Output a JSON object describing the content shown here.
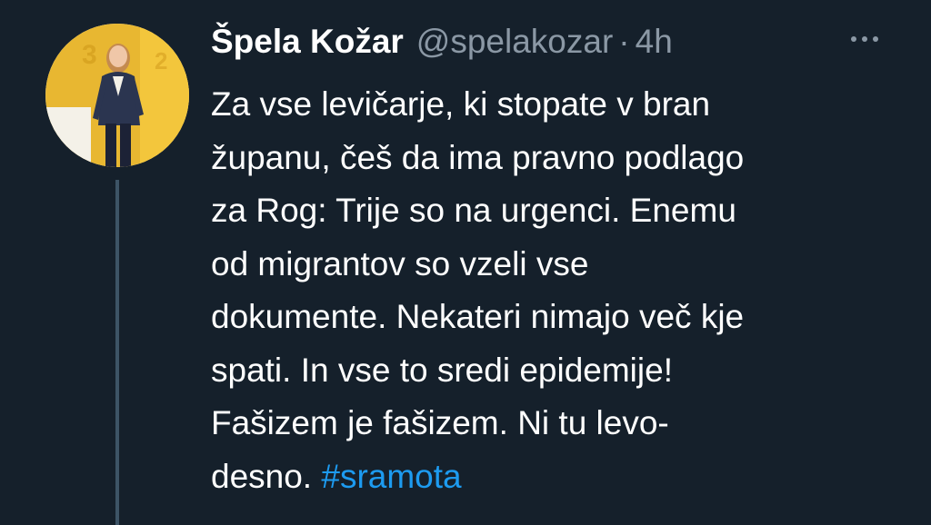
{
  "tweet": {
    "display_name": "Špela Kožar",
    "handle": "@spelakozar",
    "separator": "·",
    "time": "4h",
    "body_lines": [
      "Za vse levičarje, ki stopate v bran",
      "županu, češ da ima pravno podlago",
      "za Rog: Trije so na urgenci. Enemu",
      "od migrantov so vzeli vse",
      "dokumente. Nekateri nimajo več kje",
      "spati. In vse to sredi epidemije!",
      "Fašizem je fašizem. Ni tu levo-"
    ],
    "last_line_text": "desno. ",
    "hashtag": "#sramota"
  },
  "icons": {
    "avatar": "profile-photo",
    "more": "more-dots-icon"
  },
  "colors": {
    "background": "#15202b",
    "text": "#ffffff",
    "secondary": "#8b98a5",
    "link": "#1d9bf0",
    "thread_line": "#3d5466"
  }
}
